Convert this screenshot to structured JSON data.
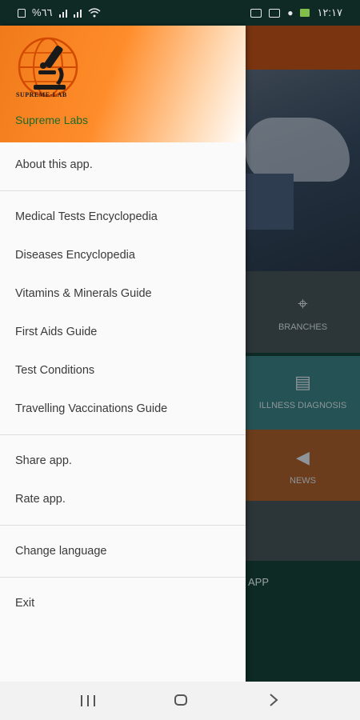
{
  "status_bar": {
    "battery": "%٦٦",
    "time": "١٢:١٧"
  },
  "drawer": {
    "logo_text": "SUPREME-LAB",
    "brand_name": "Supreme Labs",
    "sections": [
      [
        "About this app."
      ],
      [
        "Medical Tests Encyclopedia",
        "Diseases Encyclopedia",
        "Vitamins & Minerals Guide",
        "First Aids Guide",
        "Test Conditions",
        "Travelling Vaccinations Guide"
      ],
      [
        "Share app.",
        "Rate app."
      ],
      [
        "Change language"
      ],
      [
        "Exit"
      ]
    ]
  },
  "background_app": {
    "tiles": [
      {
        "label": "BRANCHES",
        "icon": "location-pins-icon"
      },
      {
        "label": "ILLNESS DIAGNOSIS",
        "icon": "hospital-bed-icon"
      },
      {
        "label": "NEWS",
        "icon": "megaphone-icon"
      }
    ],
    "footer_label": "APP"
  },
  "nav_bar": {
    "buttons": [
      "recents",
      "home",
      "back"
    ]
  },
  "colors": {
    "brand_orange": "#ff8c2a",
    "brand_green": "#1b6a2b",
    "status_bg": "#0f2a24"
  }
}
